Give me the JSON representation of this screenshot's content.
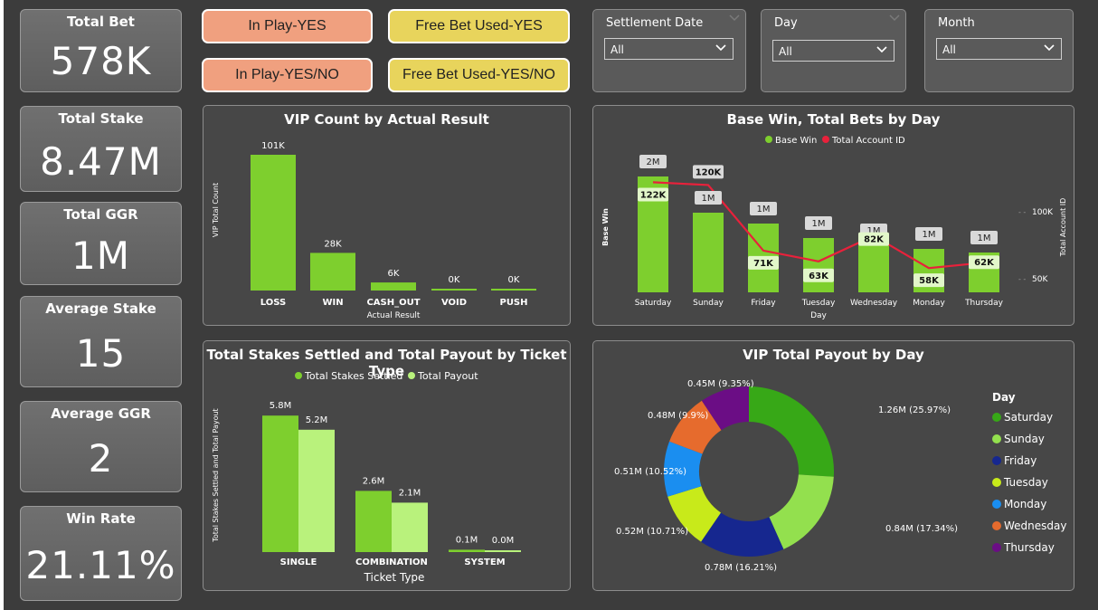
{
  "kpis": [
    {
      "title": "Total Bet",
      "value": "578K"
    },
    {
      "title": "Total Stake",
      "value": "8.47M"
    },
    {
      "title": "Total GGR",
      "value": "1M"
    },
    {
      "title": "Average Stake",
      "value": "15"
    },
    {
      "title": "Average GGR",
      "value": "2"
    },
    {
      "title": "Win Rate",
      "value": "21.11%"
    }
  ],
  "buttons": {
    "in_play_yes": "In Play-YES",
    "in_play_yes_no": "In Play-YES/NO",
    "free_bet_yes": "Free Bet Used-YES",
    "free_bet_yes_no": "Free Bet Used-YES/NO"
  },
  "filters": {
    "settlement_date": {
      "label": "Settlement Date",
      "value": "All"
    },
    "day": {
      "label": "Day",
      "value": "All"
    },
    "month": {
      "label": "Month",
      "value": "All"
    }
  },
  "colors": {
    "salmon": "#f0a07f",
    "yellow": "#e8d45c",
    "green_bar": "#7ecf2e",
    "light_green": "#b9f27c",
    "red_line": "#e8213b"
  },
  "chart_data": [
    {
      "type": "bar",
      "title": "VIP Count by Actual Result",
      "xlabel": "Actual Result",
      "ylabel": "VIP Total Count",
      "categories": [
        "LOSS",
        "WIN",
        "CASH_OUT",
        "VOID",
        "PUSH"
      ],
      "values": [
        101000,
        28000,
        6000,
        0,
        0
      ],
      "data_labels": [
        "101K",
        "28K",
        "6K",
        "0K",
        "0K"
      ]
    },
    {
      "type": "bar",
      "title": "Base Win, Total Bets by Day",
      "xlabel": "Day",
      "ylabel": "Base Win",
      "y2label": "Total Account ID",
      "y2_ticks": [
        "100K",
        "50K"
      ],
      "legend": [
        "Base Win",
        "Total Account ID"
      ],
      "categories": [
        "Saturday",
        "Sunday",
        "Friday",
        "Tuesday",
        "Wednesday",
        "Monday",
        "Thursday"
      ],
      "series": [
        {
          "name": "Base Win",
          "labels": [
            "2M",
            "1M",
            "1M",
            "1M",
            "1M",
            "1M",
            "1M"
          ],
          "values": [
            1.6,
            1.1,
            0.95,
            0.75,
            0.65,
            0.6,
            0.55
          ]
        },
        {
          "name": "Total Account ID",
          "labels": [
            "122K",
            "120K",
            "71K",
            "63K",
            "82K",
            "58K",
            "62K"
          ],
          "values": [
            122000,
            120000,
            71000,
            63000,
            82000,
            58000,
            62000
          ]
        }
      ]
    },
    {
      "type": "bar",
      "title": "Total Stakes Settled and Total Payout by Ticket Type",
      "xlabel": "Ticket Type",
      "ylabel": "Total Stakes Settled and Total Payout",
      "legend": [
        "Total Stakes Settled",
        "Total Payout"
      ],
      "categories": [
        "SINGLE",
        "COMBINATION",
        "SYSTEM"
      ],
      "series": [
        {
          "name": "Total Stakes Settled",
          "values": [
            5.8,
            2.6,
            0.1
          ],
          "labels": [
            "5.8M",
            "2.6M",
            "0.1M"
          ]
        },
        {
          "name": "Total Payout",
          "values": [
            5.2,
            2.1,
            0.0
          ],
          "labels": [
            "5.2M",
            "2.1M",
            "0.0M"
          ]
        }
      ]
    },
    {
      "type": "pie",
      "title": "VIP Total Payout by Day",
      "legend_title": "Day",
      "categories": [
        "Saturday",
        "Sunday",
        "Friday",
        "Tuesday",
        "Monday",
        "Wednesday",
        "Thursday"
      ],
      "values": [
        25.97,
        17.34,
        16.21,
        10.71,
        10.52,
        9.9,
        9.35
      ],
      "labels": [
        "1.26M (25.97%)",
        "0.84M (17.34%)",
        "0.78M (16.21%)",
        "0.52M (10.71%)",
        "0.51M (10.52%)",
        "0.48M (9.9%)",
        "0.45M (9.35%)"
      ],
      "colors": [
        "#37a817",
        "#93e04e",
        "#16278f",
        "#c8ea1a",
        "#1a8ef0",
        "#e66b2d",
        "#6b0d85"
      ]
    }
  ]
}
